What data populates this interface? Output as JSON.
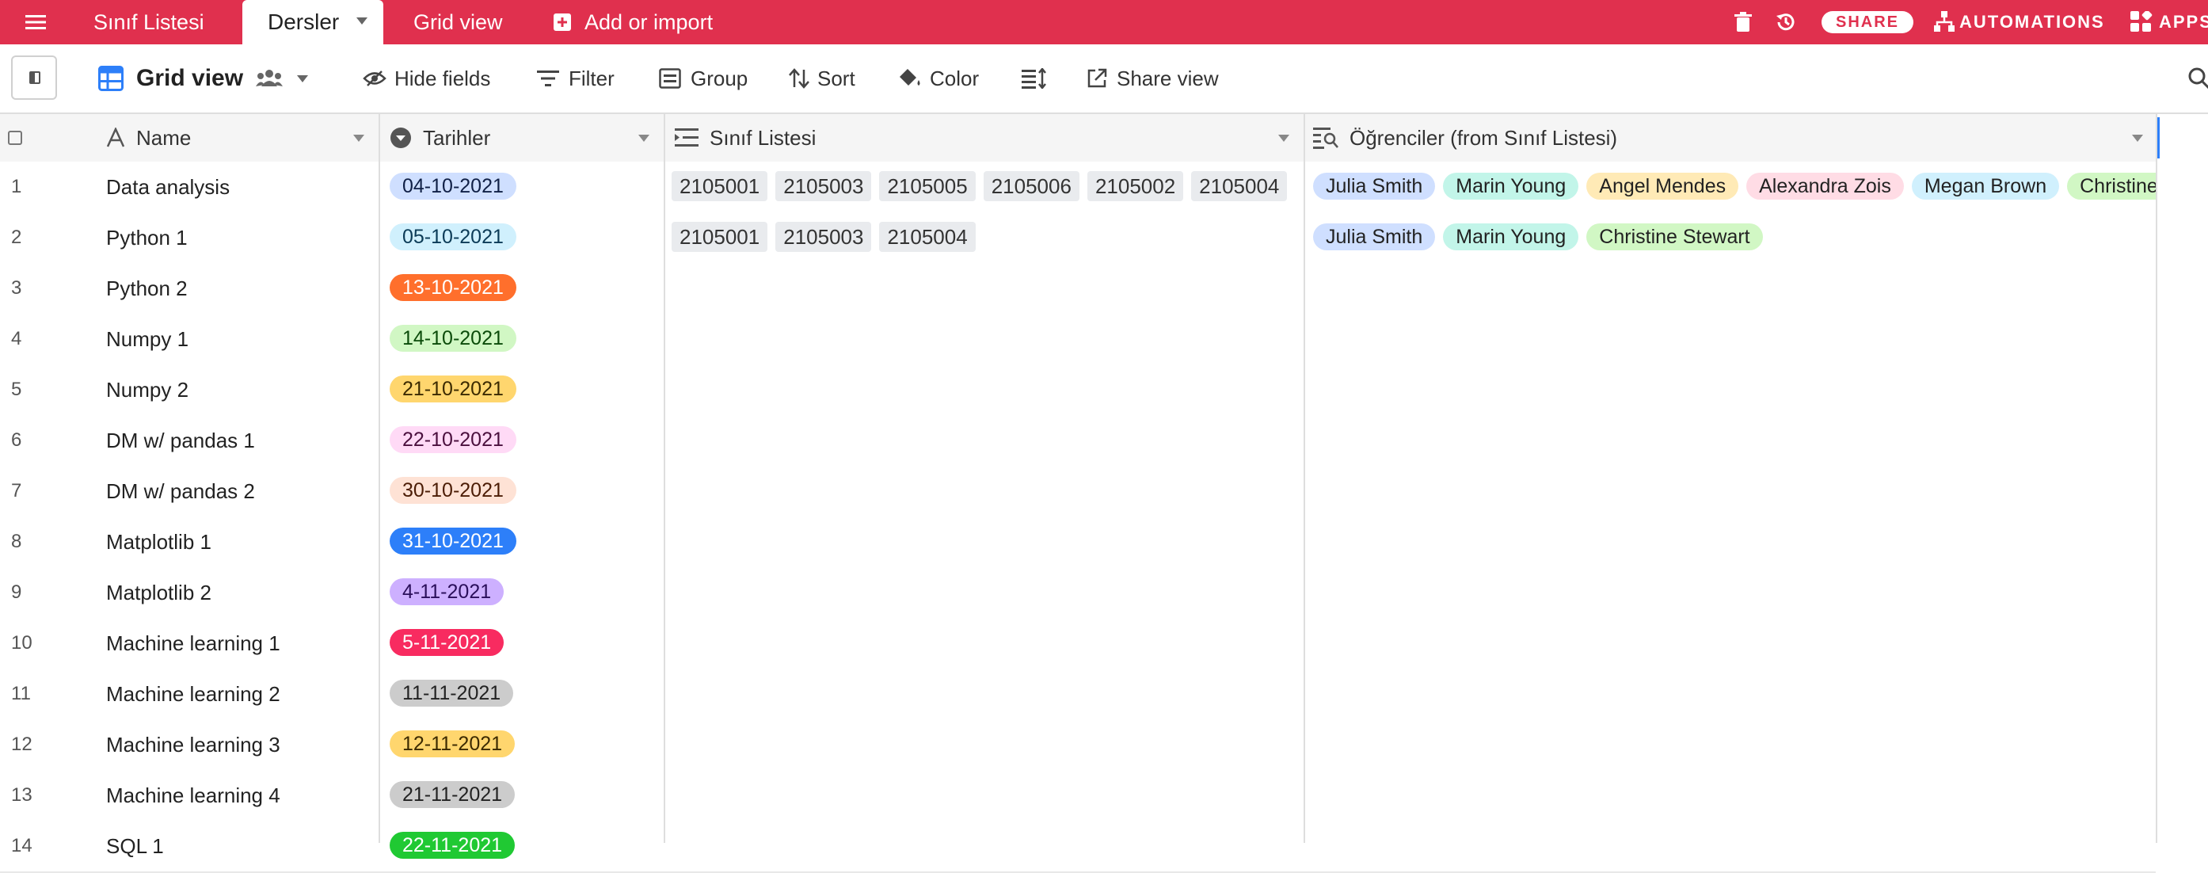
{
  "topbar": {
    "tabs": [
      {
        "label": "Sınıf Listesi"
      },
      {
        "label": "Dersler"
      },
      {
        "label": "Grid view"
      }
    ],
    "add_import": "Add or import",
    "share": "SHARE",
    "automations": "AUTOMATIONS",
    "apps": "APPS"
  },
  "toolbar": {
    "view_name": "Grid view",
    "hide_fields": "Hide fields",
    "filter": "Filter",
    "group": "Group",
    "sort": "Sort",
    "color": "Color",
    "share_view": "Share view"
  },
  "columns": {
    "name": "Name",
    "dates": "Tarihler",
    "class_list": "Sınıf Listesi",
    "students": "Öğrenciler (from Sınıf Listesi)"
  },
  "rows": [
    {
      "num": "1",
      "name": "Data analysis",
      "date": "04-10-2021",
      "date_bg": "#cfdfff",
      "date_fg": "#102046",
      "links": [
        "2105001",
        "2105003",
        "2105005",
        "2105006",
        "2105002",
        "2105004"
      ],
      "students": [
        {
          "name": "Julia Smith",
          "bg": "#cfdfff"
        },
        {
          "name": "Marin Young",
          "bg": "#c2f5e9"
        },
        {
          "name": "Angel Mendes",
          "bg": "#ffeab6"
        },
        {
          "name": "Alexandra Zois",
          "bg": "#ffdce5"
        },
        {
          "name": "Megan Brown",
          "bg": "#d0f0fd"
        },
        {
          "name": "Christine Stewart",
          "bg": "#d1f7c4"
        }
      ]
    },
    {
      "num": "2",
      "name": "Python 1",
      "date": "05-10-2021",
      "date_bg": "#d0f0fd",
      "date_fg": "#0b3b57",
      "links": [
        "2105001",
        "2105003",
        "2105004"
      ],
      "students": [
        {
          "name": "Julia Smith",
          "bg": "#cfdfff"
        },
        {
          "name": "Marin Young",
          "bg": "#c2f5e9"
        },
        {
          "name": "Christine Stewart",
          "bg": "#d1f7c4"
        }
      ]
    },
    {
      "num": "3",
      "name": "Python 2",
      "date": "13-10-2021",
      "date_bg": "#ff6f2c",
      "date_fg": "#ffffff",
      "links": [],
      "students": []
    },
    {
      "num": "4",
      "name": "Numpy 1",
      "date": "14-10-2021",
      "date_bg": "#d1f7c4",
      "date_fg": "#0b4b0a",
      "links": [],
      "students": []
    },
    {
      "num": "5",
      "name": "Numpy 2",
      "date": "21-10-2021",
      "date_bg": "#ffd66e",
      "date_fg": "#3b2a00",
      "links": [],
      "students": []
    },
    {
      "num": "6",
      "name": "DM w/ pandas 1",
      "date": "22-10-2021",
      "date_bg": "#ffdaf6",
      "date_fg": "#4a0f3d",
      "links": [],
      "students": []
    },
    {
      "num": "7",
      "name": "DM w/ pandas 2",
      "date": "30-10-2021",
      "date_bg": "#fee2d5",
      "date_fg": "#4b1c05",
      "links": [],
      "students": []
    },
    {
      "num": "8",
      "name": "Matplotlib 1",
      "date": "31-10-2021",
      "date_bg": "#2d7ff9",
      "date_fg": "#ffffff",
      "links": [],
      "students": []
    },
    {
      "num": "9",
      "name": "Matplotlib 2",
      "date": "4-11-2021",
      "date_bg": "#cdb0ff",
      "date_fg": "#2a0f5a",
      "links": [],
      "students": []
    },
    {
      "num": "10",
      "name": "Machine learning 1",
      "date": "5-11-2021",
      "date_bg": "#f82b60",
      "date_fg": "#ffffff",
      "links": [],
      "students": []
    },
    {
      "num": "11",
      "name": "Machine learning 2",
      "date": "11-11-2021",
      "date_bg": "#cccccc",
      "date_fg": "#222222",
      "links": [],
      "students": []
    },
    {
      "num": "12",
      "name": "Machine learning 3",
      "date": "12-11-2021",
      "date_bg": "#ffd66e",
      "date_fg": "#3b2a00",
      "links": [],
      "students": []
    },
    {
      "num": "13",
      "name": "Machine learning 4",
      "date": "21-11-2021",
      "date_bg": "#cccccc",
      "date_fg": "#222222",
      "links": [],
      "students": []
    },
    {
      "num": "14",
      "name": "SQL 1",
      "date": "22-11-2021",
      "date_bg": "#20c933",
      "date_fg": "#ffffff",
      "links": [],
      "students": []
    }
  ]
}
